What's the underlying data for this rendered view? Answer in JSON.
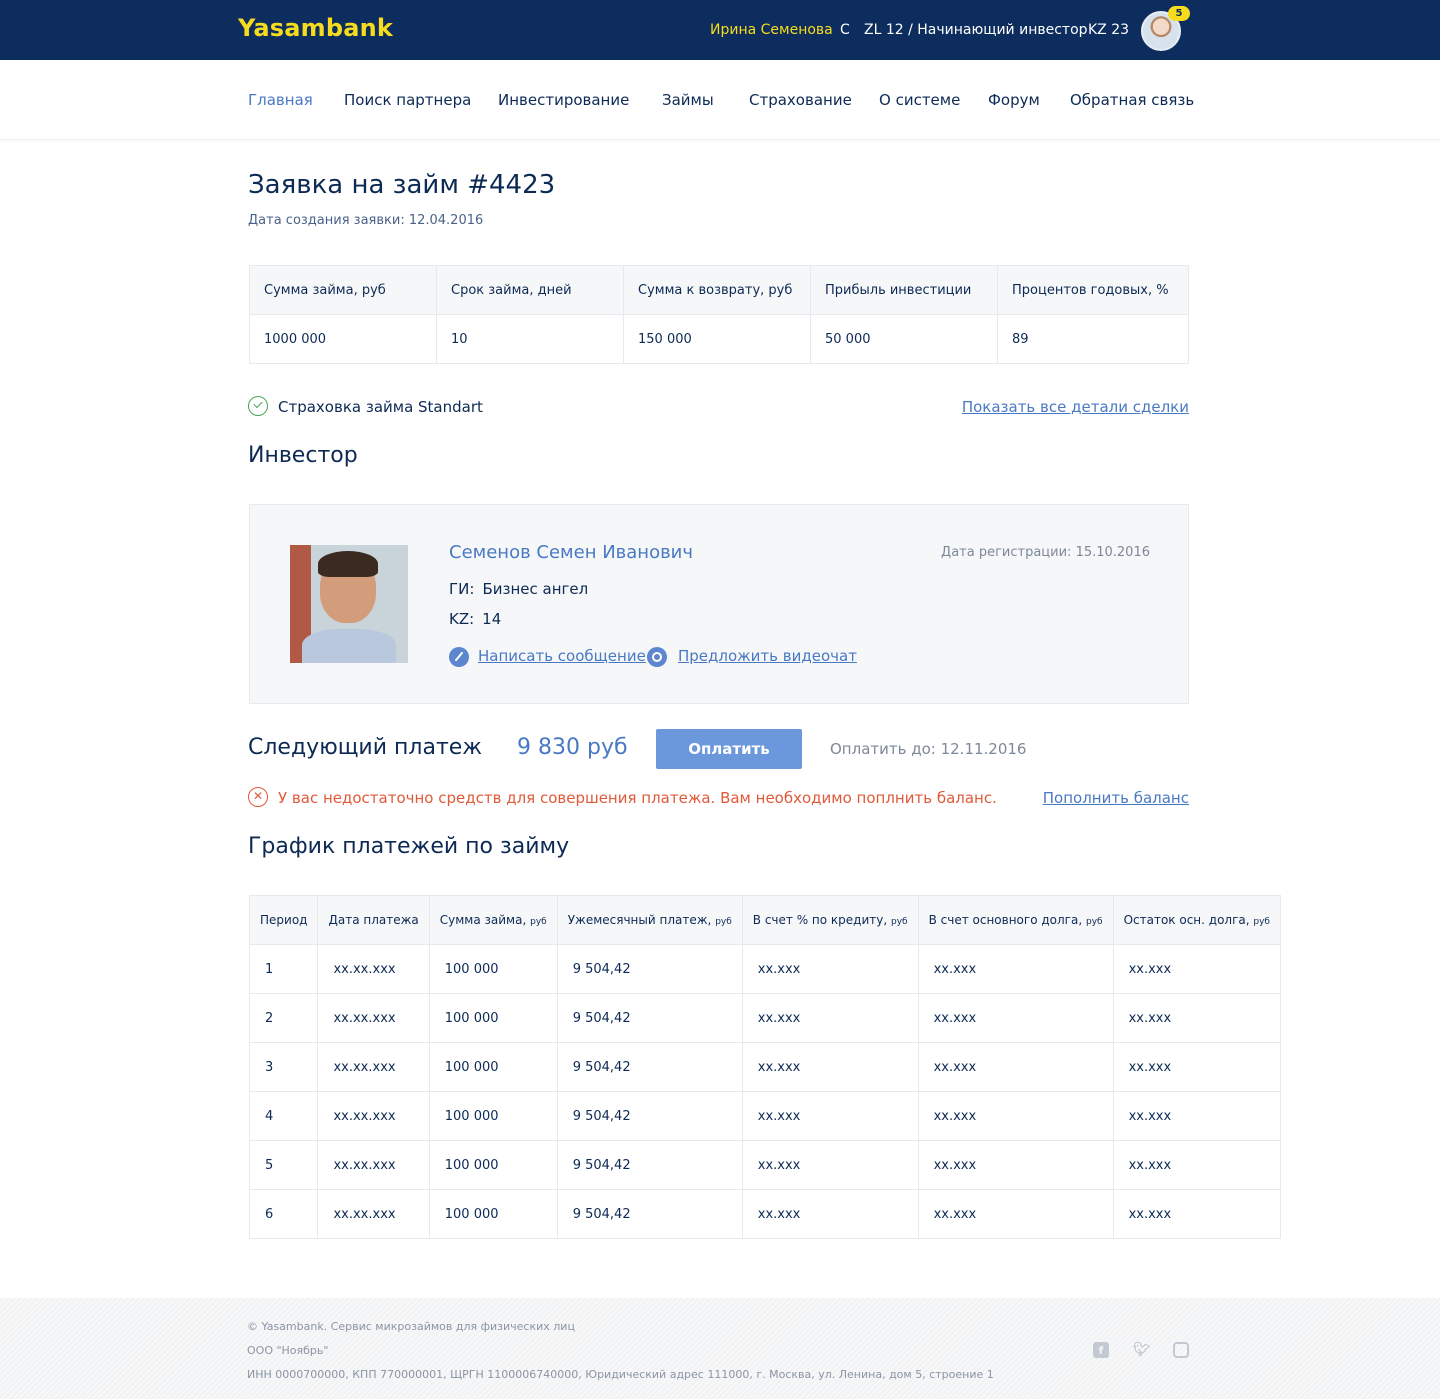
{
  "header": {
    "logo": "Yasambank",
    "user_name": "Ирина Семенова",
    "user_c": "С",
    "user_level": "ZL 12 / Начинающий инвестор",
    "user_kz": "KZ 23",
    "notifications": "5"
  },
  "nav": {
    "items": [
      "Главная",
      "Поиск партнера",
      "Инвестирование",
      "Займы",
      "Страхование",
      "О системе",
      "Форум",
      "Обратная связь"
    ],
    "active": "Главная"
  },
  "page": {
    "title": "Заявка на займ #4423",
    "created": "Дата создания заявки: 12.04.2016"
  },
  "summary": {
    "headers": [
      "Сумма займа, руб",
      "Срок займа, дней",
      "Сумма к возврату, руб",
      "Прибыль инвестиции",
      "Процентов годовых, %"
    ],
    "values": [
      "1000 000",
      "10",
      "150 000",
      "50 000",
      "89"
    ]
  },
  "insurance": {
    "label": "Страховка займа Standart",
    "details_link": "Показать все детали сделки"
  },
  "investor": {
    "heading": "Инвестор",
    "name": "Семенов Семен Иванович",
    "registered": "Дата регистрации: 15.10.2016",
    "gi_label": "ГИ:",
    "gi_value": "Бизнес ангел",
    "kz_label": "KZ:",
    "kz_value": "14",
    "message_link": "Написать сообщение",
    "video_link": "Предложить видеочат"
  },
  "next_payment": {
    "title": "Следующий платеж",
    "amount": "9 830 руб",
    "button": "Оплатить",
    "due": "Оплатить до: 12.11.2016",
    "error": "У вас недостаточно средств для совершения платежа. Вам необходимо поплнить баланс.",
    "topup_link": "Пополнить баланс"
  },
  "schedule": {
    "heading": "График платежей по займу",
    "headers": [
      {
        "label": "Период",
        "unit": ""
      },
      {
        "label": "Дата платежа",
        "unit": ""
      },
      {
        "label": "Сумма займа,",
        "unit": "руб"
      },
      {
        "label": "Ужемесячный платеж,",
        "unit": "руб"
      },
      {
        "label": "В счет % по кредиту,",
        "unit": "руб"
      },
      {
        "label": "В счет основного долга,",
        "unit": "руб"
      },
      {
        "label": "Остаток осн. долга,",
        "unit": "руб"
      }
    ],
    "rows": [
      [
        "1",
        "xx.xx.xxx",
        "100 000",
        "9 504,42",
        "xx.xxx",
        "xx.xxx",
        "xx.xxx"
      ],
      [
        "2",
        "xx.xx.xxx",
        "100 000",
        "9 504,42",
        "xx.xxx",
        "xx.xxx",
        "xx.xxx"
      ],
      [
        "3",
        "xx.xx.xxx",
        "100 000",
        "9 504,42",
        "xx.xxx",
        "xx.xxx",
        "xx.xxx"
      ],
      [
        "4",
        "xx.xx.xxx",
        "100 000",
        "9 504,42",
        "xx.xxx",
        "xx.xxx",
        "xx.xxx"
      ],
      [
        "5",
        "xx.xx.xxx",
        "100 000",
        "9 504,42",
        "xx.xxx",
        "xx.xxx",
        "xx.xxx"
      ],
      [
        "6",
        "xx.xx.xxx",
        "100 000",
        "9 504,42",
        "xx.xxx",
        "xx.xxx",
        "xx.xxx"
      ]
    ]
  },
  "footer": {
    "line1": "© Yasambank. Сервис микрозаймов для физических лиц",
    "line2": "ООО \"Ноябрь\"",
    "line3": "ИНН 0000700000, КПП 770000001, ЩРГН 1100006740000, Юридический адрес 111000, г. Москва, ул. Ленина, дом 5, строение 1",
    "social": [
      "facebook-icon",
      "twitter-icon",
      "instagram-icon"
    ]
  }
}
